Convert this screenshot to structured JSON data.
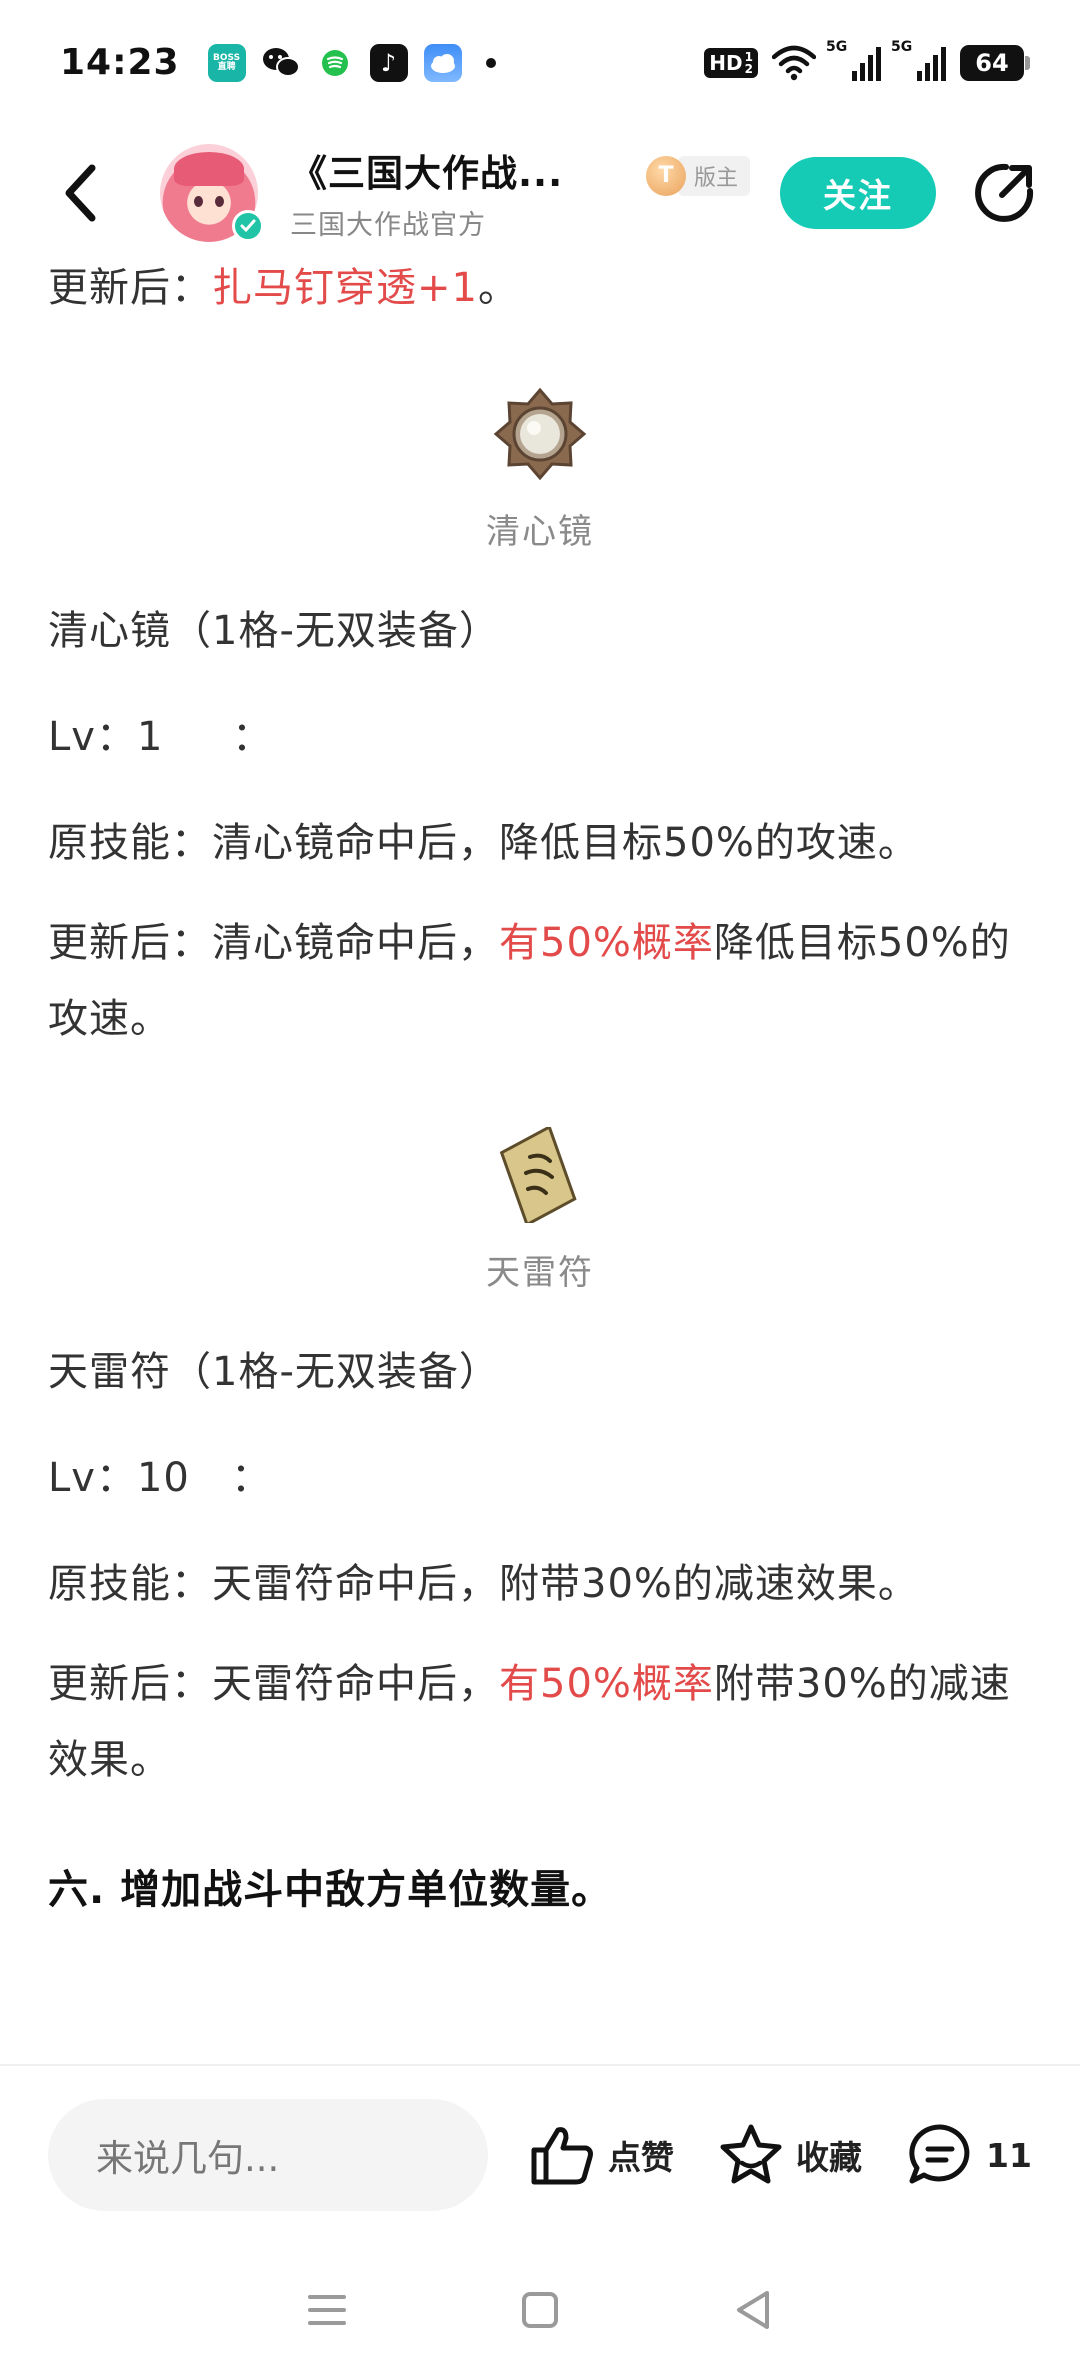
{
  "status_bar": {
    "time": "14:23",
    "app_icons": [
      "boss-zhipin-icon",
      "wechat-icon",
      "messaging-icon",
      "tiktok-icon",
      "weather-icon"
    ],
    "boss_label": "BOSS\n直聘",
    "hd_label": "HD",
    "hd_sub_top": "1",
    "hd_sub_bottom": "2",
    "signal1_label": "5G",
    "signal2_label": "5G",
    "battery": "64"
  },
  "header": {
    "title": "《三国大作战...",
    "subtitle": "三国大作战官方",
    "role_coin": "T",
    "role_tag": "版主",
    "follow_label": "关注"
  },
  "article": {
    "line_prev_prefix": "更新后：",
    "line_prev_red": "扎马钉穿透+1",
    "line_prev_suffix": "。",
    "item1": {
      "icon": "qingxin-mirror-icon",
      "caption": "清心镜",
      "name_line": "清心镜（1格-无双装备）",
      "lv_line": "Lv：1     ：",
      "orig_line": "原技能：清心镜命中后，降低目标50%的攻速。",
      "upd_prefix": "更新后：清心镜命中后，",
      "upd_red": "有50%概率",
      "upd_suffix": "降低目标50%的攻速。"
    },
    "item2": {
      "icon": "tianlei-talisman-icon",
      "caption": "天雷符",
      "name_line": "天雷符（1格-无双装备）",
      "lv_line": "Lv：10   ：",
      "orig_line": "原技能：天雷符命中后，附带30%的减速效果。",
      "upd_prefix": "更新后：天雷符命中后，",
      "upd_red": "有50%概率",
      "upd_suffix": "附带30%的减速效果。"
    },
    "section_heading": "六. 增加战斗中敌方单位数量。"
  },
  "bottom_bar": {
    "comment_placeholder": "来说几句...",
    "like_label": "点赞",
    "favorite_label": "收藏",
    "comment_count": "11"
  },
  "colors": {
    "accent": "#16cbb6",
    "highlight_red": "#e34a4a",
    "text": "#333333"
  }
}
